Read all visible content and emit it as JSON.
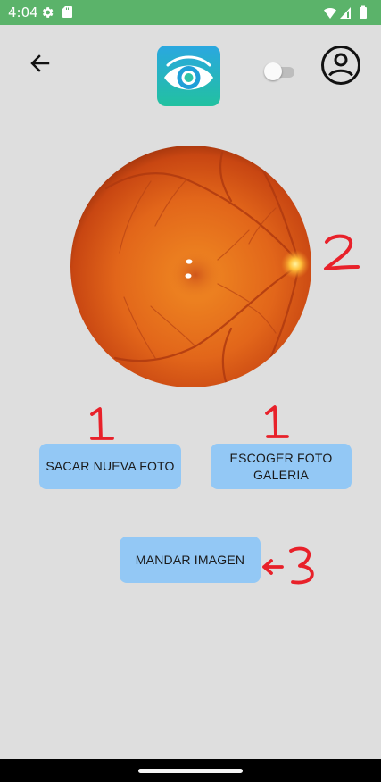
{
  "status_bar": {
    "time": "4:04",
    "icons": [
      "gear-icon",
      "sd-card-icon",
      "wifi-icon",
      "signal-icon",
      "battery-icon"
    ],
    "background": "#5bb36a"
  },
  "app_bar": {
    "back_icon": "arrow-left-icon",
    "logo_icon": "eye-logo-icon",
    "toggle_on": false,
    "profile_icon": "account-circle-icon"
  },
  "image": {
    "subject": "retina-fundus-photo"
  },
  "buttons": {
    "take_photo": "SACAR NUEVA FOTO",
    "gallery": "ESCOGER FOTO\nGALERIA",
    "send": "MANDAR IMAGEN"
  },
  "annotations": {
    "label_take": "1",
    "label_gallery": "1",
    "label_image": "2",
    "label_send": "3",
    "color": "#e8212a"
  },
  "colors": {
    "background": "#dedede",
    "button": "#93c8f5",
    "logo_top": "#2aa7e0",
    "logo_bottom": "#22c1a0"
  }
}
